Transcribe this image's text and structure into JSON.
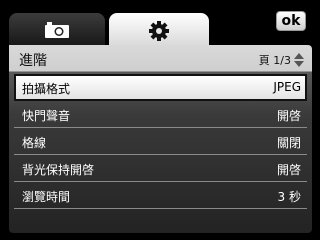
{
  "tabs": [
    {
      "name": "camera",
      "icon": "camera-icon"
    },
    {
      "name": "settings",
      "icon": "gear-icon"
    }
  ],
  "ok_button": {
    "label": "ok"
  },
  "section": {
    "title": "進階",
    "page_indicator": "頁 1/3"
  },
  "settings": [
    {
      "label": "拍攝格式",
      "value": "JPEG"
    },
    {
      "label": "快門聲音",
      "value": "開啓"
    },
    {
      "label": "格線",
      "value": "關閉"
    },
    {
      "label": "背光保持開啓",
      "value": "開啓"
    },
    {
      "label": "瀏覽時間",
      "value": "3 秒"
    }
  ],
  "colors": {
    "selected_border": "#111111",
    "header_bg": "#d9d9d9"
  }
}
